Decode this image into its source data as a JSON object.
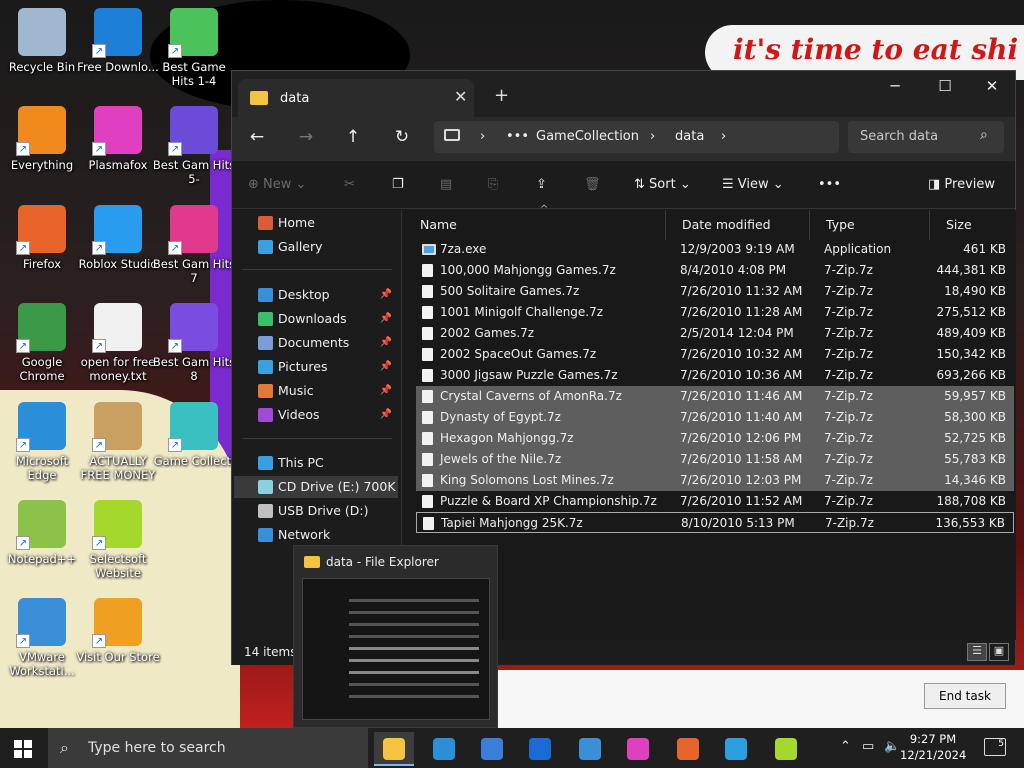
{
  "desktop": {
    "wallpaper_text": "it's time to eat shi",
    "icons": [
      {
        "label": "Recycle Bin",
        "icon": "recycle-bin-icon",
        "color": "#9fb8d0"
      },
      {
        "label": "Free Downlo...",
        "icon": "free-download-icon",
        "color": "#1e7fd8"
      },
      {
        "label": "Best Game Hits 1-4",
        "icon": "dice-icon",
        "color": "#4cc35a"
      },
      {
        "label": "Everything",
        "icon": "everything-icon",
        "color": "#f08a1c"
      },
      {
        "label": "Plasmafox",
        "icon": "plasmafox-icon",
        "color": "#e040c0"
      },
      {
        "label": "Best Gam Hits 5-",
        "icon": "dice-icon",
        "color": "#6a4cd8"
      },
      {
        "label": "Firefox",
        "icon": "firefox-icon",
        "color": "#e8642a"
      },
      {
        "label": "Roblox Studio",
        "icon": "roblox-studio-icon",
        "color": "#2a9cf0"
      },
      {
        "label": "Best Gam Hits 7",
        "icon": "dice-icon",
        "color": "#e03a8c"
      },
      {
        "label": "Google Chrome",
        "icon": "chrome-icon",
        "color": "#3a9a48"
      },
      {
        "label": "open for free money.txt",
        "icon": "text-file-icon",
        "color": "#f0f0f0"
      },
      {
        "label": "Best Gam Hits 8",
        "icon": "dice-icon",
        "color": "#7a4ce0"
      },
      {
        "label": "Microsoft Edge",
        "icon": "edge-icon",
        "color": "#2a8fd8"
      },
      {
        "label": "ACTUALLY FREE MONEY",
        "icon": "money-bag-icon",
        "color": "#c9a060"
      },
      {
        "label": "Game Collecti",
        "icon": "dice-icon",
        "color": "#3ac0c0"
      },
      {
        "label": "Notepad++",
        "icon": "notepadpp-icon",
        "color": "#8bc34a"
      },
      {
        "label": "Selectsoft Website",
        "icon": "selectsoft-icon",
        "color": "#a4d82a"
      },
      {
        "label": "VMware Workstati...",
        "icon": "vmware-icon",
        "color": "#3a8fd8"
      },
      {
        "label": "Visit Our Store",
        "icon": "store-icon",
        "color": "#f0a020"
      }
    ]
  },
  "explorer": {
    "tab_title": "data",
    "search_placeholder": "Search data",
    "breadcrumb": [
      "GameCollection",
      "data"
    ],
    "toolbar": {
      "new": "New",
      "sort": "Sort",
      "view": "View",
      "more": "•••",
      "preview": "Preview"
    },
    "sidebar": {
      "top": [
        {
          "label": "Home",
          "color": "#e05a3a"
        },
        {
          "label": "Gallery",
          "color": "#3aa0e0"
        }
      ],
      "quick": [
        {
          "label": "Desktop",
          "color": "#3a8fd8"
        },
        {
          "label": "Downloads",
          "color": "#3ac06a"
        },
        {
          "label": "Documents",
          "color": "#7a9fd8"
        },
        {
          "label": "Pictures",
          "color": "#3aa0e0"
        },
        {
          "label": "Music",
          "color": "#e07a3a"
        },
        {
          "label": "Videos",
          "color": "#a04ad8"
        }
      ],
      "drives": [
        {
          "label": "This PC",
          "color": "#3a9fe0"
        },
        {
          "label": "CD Drive (E:) 700K",
          "color": "#8ad0e0"
        },
        {
          "label": "USB Drive (D:)",
          "color": "#c0c0c0"
        },
        {
          "label": "Network",
          "color": "#3a8fd8"
        }
      ]
    },
    "columns": [
      "Name",
      "Date modified",
      "Type",
      "Size"
    ],
    "files": [
      {
        "name": "7za.exe",
        "date": "12/9/2003 9:19 AM",
        "type": "Application",
        "size": "461 KB",
        "exe": true,
        "selected": false
      },
      {
        "name": "100,000 Mahjongg Games.7z",
        "date": "8/4/2010 4:08 PM",
        "type": "7-Zip.7z",
        "size": "444,381 KB",
        "selected": false
      },
      {
        "name": "500 Solitaire Games.7z",
        "date": "7/26/2010 11:32 AM",
        "type": "7-Zip.7z",
        "size": "18,490 KB",
        "selected": false
      },
      {
        "name": "1001 Minigolf Challenge.7z",
        "date": "7/26/2010 11:28 AM",
        "type": "7-Zip.7z",
        "size": "275,512 KB",
        "selected": false
      },
      {
        "name": "2002 Games.7z",
        "date": "2/5/2014 12:04 PM",
        "type": "7-Zip.7z",
        "size": "489,409 KB",
        "selected": false
      },
      {
        "name": "2002 SpaceOut Games.7z",
        "date": "7/26/2010 10:32 AM",
        "type": "7-Zip.7z",
        "size": "150,342 KB",
        "selected": false
      },
      {
        "name": "3000 Jigsaw Puzzle Games.7z",
        "date": "7/26/2010 10:36 AM",
        "type": "7-Zip.7z",
        "size": "693,266 KB",
        "selected": false
      },
      {
        "name": "Crystal Caverns of AmonRa.7z",
        "date": "7/26/2010 11:46 AM",
        "type": "7-Zip.7z",
        "size": "59,957 KB",
        "selected": true
      },
      {
        "name": "Dynasty of Egypt.7z",
        "date": "7/26/2010 11:40 AM",
        "type": "7-Zip.7z",
        "size": "58,300 KB",
        "selected": true
      },
      {
        "name": "Hexagon Mahjongg.7z",
        "date": "7/26/2010 12:06 PM",
        "type": "7-Zip.7z",
        "size": "52,725 KB",
        "selected": true
      },
      {
        "name": "Jewels of the Nile.7z",
        "date": "7/26/2010 11:58 AM",
        "type": "7-Zip.7z",
        "size": "55,783 KB",
        "selected": true
      },
      {
        "name": "King Solomons Lost Mines.7z",
        "date": "7/26/2010 12:03 PM",
        "type": "7-Zip.7z",
        "size": "14,346 KB",
        "selected": true
      },
      {
        "name": "Puzzle & Board XP Championship.7z",
        "date": "7/26/2010 11:52 AM",
        "type": "7-Zip.7z",
        "size": "188,708 KB",
        "selected": false
      },
      {
        "name": "Tapiei Mahjongg 25K.7z",
        "date": "8/10/2010 5:13 PM",
        "type": "7-Zip.7z",
        "size": "136,553 KB",
        "selected": false,
        "focused": true
      }
    ],
    "status": "14 items"
  },
  "thumbnail": {
    "title": "data - File Explorer"
  },
  "taskmanager": {
    "end_task": "End task"
  },
  "taskbar": {
    "search_placeholder": "Type here to search",
    "apps": [
      {
        "name": "file-explorer",
        "color": "#f5c242",
        "active": true
      },
      {
        "name": "edge",
        "color": "#2a8fd8"
      },
      {
        "name": "microsoft-store",
        "color": "#3a7fd8"
      },
      {
        "name": "outlook",
        "color": "#1a6bd6"
      },
      {
        "name": "vmware",
        "color": "#3a8fd8"
      },
      {
        "name": "plasmafox",
        "color": "#e040c0"
      },
      {
        "name": "firefox",
        "color": "#e8642a"
      },
      {
        "name": "sheet-app",
        "color": "#2aa0e0"
      },
      {
        "name": "selectsoft",
        "color": "#a4d82a"
      }
    ],
    "time": "9:27 PM",
    "date": "12/21/2024",
    "notifications": "5"
  }
}
